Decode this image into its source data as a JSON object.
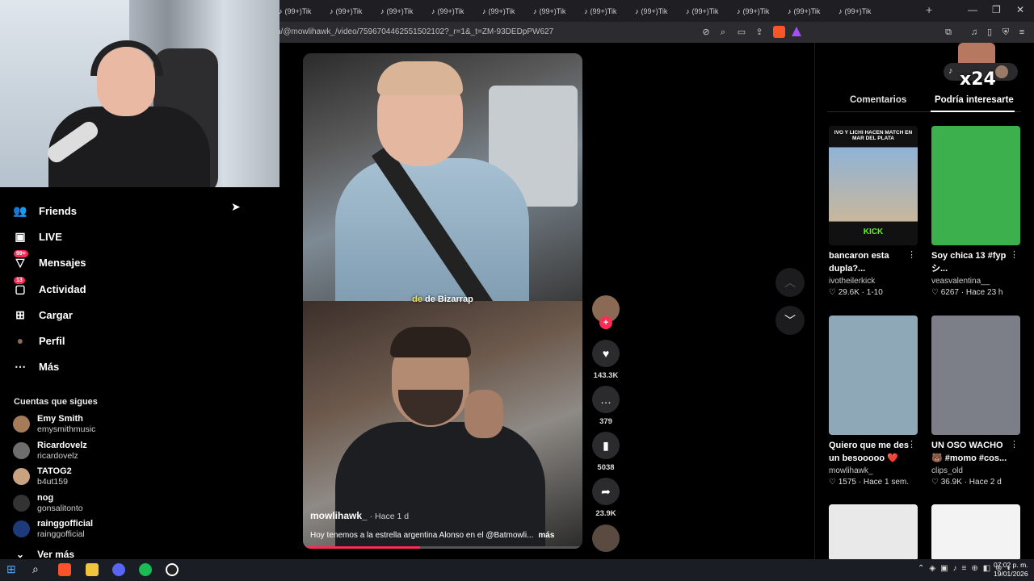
{
  "browser": {
    "tabs": [
      "(99+)Tik",
      "(99+)Tik",
      "(99+)Tik",
      "(99+)Tik",
      "(99+)Tik",
      "(99+)Tik",
      "(99+)Tik",
      "(99+)Tik",
      "(99+)Tik",
      "(99+)Tik",
      "(99+)Tik",
      "(99+)Tik"
    ],
    "new_tab": "+",
    "url": "n/@mowlihawk_/video/7596704462551502102?_r=1&_t=ZM-93DEDpPW627"
  },
  "sidebar": {
    "items": [
      {
        "label": "Friends",
        "icon": "friends-icon",
        "badge": ""
      },
      {
        "label": "LIVE",
        "icon": "live-icon",
        "badge": ""
      },
      {
        "label": "Mensajes",
        "icon": "messages-icon",
        "badge": "99+"
      },
      {
        "label": "Actividad",
        "icon": "activity-icon",
        "badge": "13"
      },
      {
        "label": "Cargar",
        "icon": "upload-icon",
        "badge": ""
      },
      {
        "label": "Perfil",
        "icon": "profile-icon",
        "badge": ""
      },
      {
        "label": "Más",
        "icon": "more-icon",
        "badge": ""
      }
    ],
    "following_title": "Cuentas que sigues",
    "following": [
      {
        "name": "Emy Smith",
        "user": "emysmithmusic"
      },
      {
        "name": "Ricardovelz",
        "user": "ricardovelz"
      },
      {
        "name": "TATOG2",
        "user": "b4ut159"
      },
      {
        "name": "nog",
        "user": "gonsalitonto"
      },
      {
        "name": "rainggofficial",
        "user": "rainggofficial"
      }
    ],
    "see_more": "Ver más"
  },
  "video": {
    "caption_highlight": "de",
    "caption_rest": " de Bizarrap",
    "author": "mowlihawk_",
    "posted": " · Hace 1 d",
    "description": "Hoy tenemos a la estrella argentina Alonso en el @Batmowli...",
    "more": "más",
    "progress": 0.42
  },
  "actions": [
    {
      "icon": "heart-icon",
      "glyph": "♥",
      "count": "143.3K"
    },
    {
      "icon": "comment-icon",
      "glyph": "…",
      "count": "379"
    },
    {
      "icon": "bookmark-icon",
      "glyph": "▮",
      "count": "5038"
    },
    {
      "icon": "share-icon",
      "glyph": "➦",
      "count": "23.9K"
    }
  ],
  "right_panel": {
    "tabs": [
      "Comentarios",
      "Podría interesarte"
    ],
    "overlay_text": "x24",
    "cards": [
      {
        "title": "bancaron esta dupla?...",
        "account": "ivotheilerkick",
        "likes": "29.6K",
        "date": "1-10",
        "thumb_text": "IVO Y LICHI HACEN MATCH EN MAR DEL PLATA",
        "thumb_sub": "KICK",
        "color": "#7a9bb8"
      },
      {
        "title": "Soy chica 13 #fyp シ...",
        "account": "veasvalentina__",
        "likes": "6267",
        "date": "Hace 23 h",
        "thumb_text": "",
        "thumb_sub": "",
        "color": "#3bb04c"
      },
      {
        "title": "Quiero que me des un besooooo ❤️",
        "account": "mowlihawk_",
        "likes": "1575",
        "date": "Hace 1 sem.",
        "thumb_text": "",
        "thumb_sub": "",
        "color": "#8fa8b8"
      },
      {
        "title": "UN OSO WACHO 🐻 #momo #cos...",
        "account": "clips_old",
        "likes": "36.9K",
        "date": "Hace 2 d",
        "thumb_text": "",
        "thumb_sub": "",
        "color": "#7c7f87"
      },
      {
        "title": "",
        "account": "",
        "likes": "",
        "date": "",
        "thumb_text": "",
        "thumb_sub": "",
        "color": "#e9e9ea"
      },
      {
        "title": "",
        "account": "",
        "likes": "",
        "date": "",
        "thumb_text": "",
        "thumb_sub": "",
        "color": "#f3f3f3"
      }
    ]
  },
  "taskbar": {
    "time": "07:02 p. m.",
    "date": "19/01/2026"
  }
}
